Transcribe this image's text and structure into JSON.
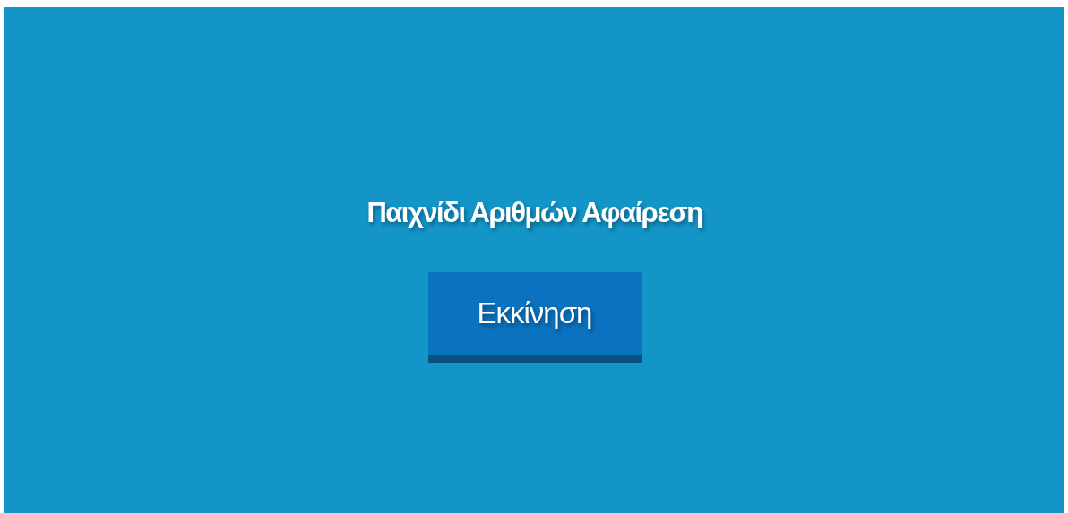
{
  "title": "Παιχνίδι Αριθμών Αφαίρεση",
  "start_button": {
    "label": "Εκκίνηση"
  }
}
